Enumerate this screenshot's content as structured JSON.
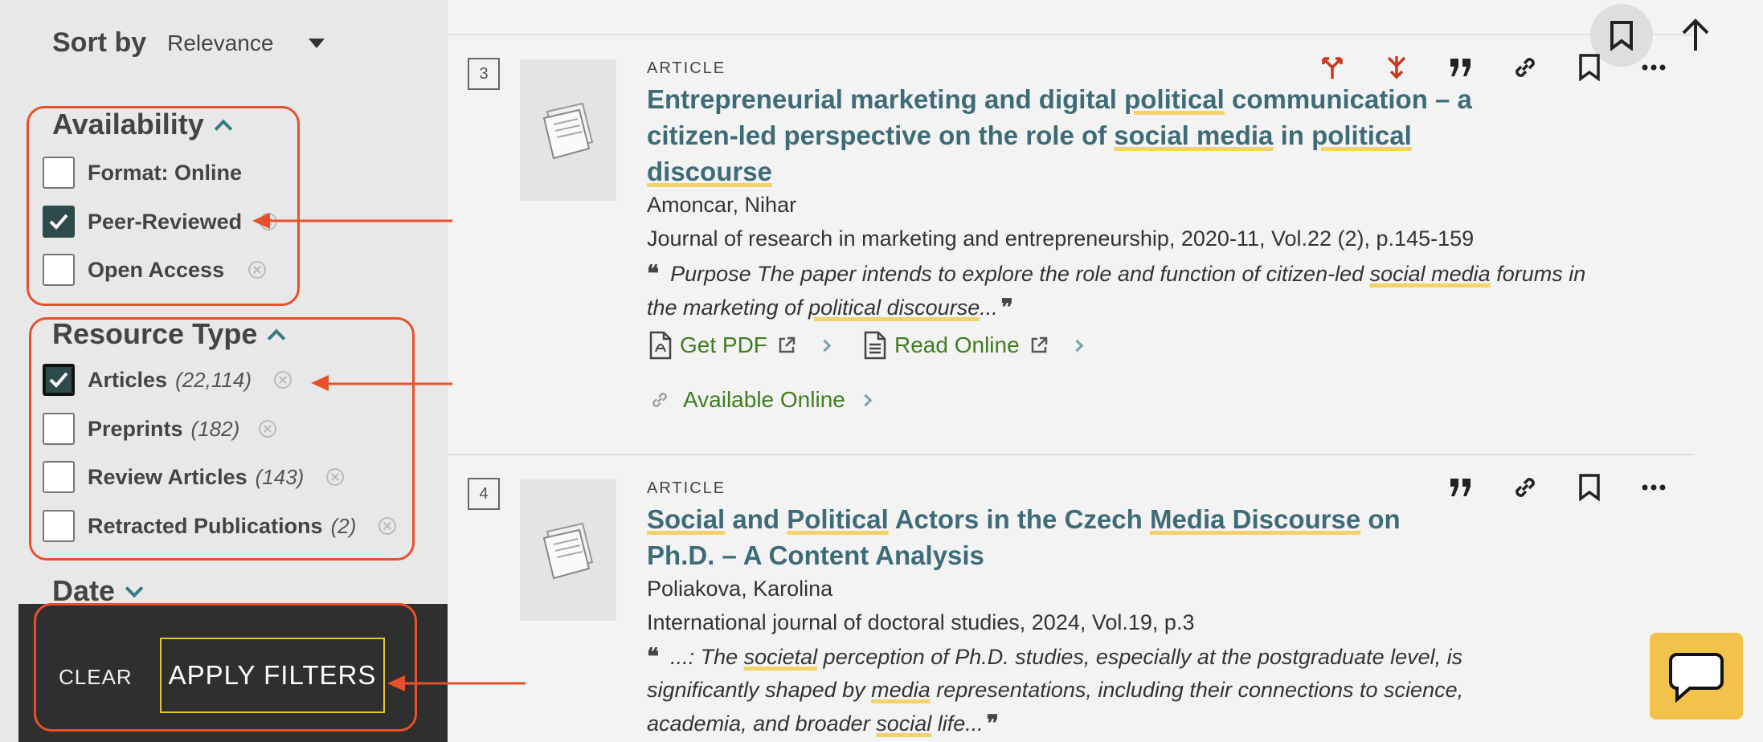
{
  "sidebar": {
    "sort_label": "Sort by",
    "sort_value": "Relevance",
    "availability": {
      "heading": "Availability",
      "options": [
        {
          "label": "Format: Online",
          "checked": false
        },
        {
          "label": "Peer-Reviewed",
          "checked": true
        },
        {
          "label": "Open Access",
          "checked": false
        }
      ]
    },
    "resource_type": {
      "heading": "Resource Type",
      "options": [
        {
          "label": "Articles",
          "count": "(22,114)",
          "checked": true
        },
        {
          "label": "Preprints",
          "count": "(182)",
          "checked": false
        },
        {
          "label": "Review Articles",
          "count": "(143)",
          "checked": false
        },
        {
          "label": "Retracted Publications",
          "count": "(2)",
          "checked": false
        }
      ]
    },
    "date_heading": "Date",
    "clear_label": "CLEAR",
    "apply_label": "APPLY FILTERS"
  },
  "results": [
    {
      "number": "3",
      "type": "ARTICLE",
      "title_parts": [
        "Entrepreneurial marketing and digital ",
        "political",
        " communication – a citizen-led perspective on the role of ",
        "social media",
        " in ",
        "political",
        " ",
        "discourse"
      ],
      "author": "Amoncar, Nihar",
      "source": "Journal of research in marketing and entrepreneurship, 2020-11, Vol.22 (2), p.145-159",
      "snippet_parts": [
        "Purpose The paper intends to explore the role and function of citizen-led ",
        "social media",
        " forums in the marketing of ",
        "political discourse",
        "..."
      ],
      "get_pdf": "Get PDF",
      "read_online": "Read Online",
      "available_online": "Available Online"
    },
    {
      "number": "4",
      "type": "ARTICLE",
      "title_parts": [
        "Social",
        " and ",
        "Political",
        " Actors in the Czech ",
        "Media Discourse",
        " on Ph.D. – A Content Analysis"
      ],
      "author": "Poliakova, Karolina",
      "source": "International journal of doctoral studies, 2024, Vol.19, p.3",
      "snippet_parts": [
        "...: The ",
        "societal",
        " perception of Ph.D. studies, especially at the postgraduate level, is significantly shaped by ",
        "media",
        " representations, including their connections to science, academia, and broader ",
        "social",
        " life..."
      ]
    }
  ],
  "colors": {
    "accent_teal": "#3e6b78",
    "link_green": "#3f7d1f",
    "annotation_red": "#e8502b",
    "highlight_yellow": "#f2d36b",
    "chat_yellow": "#f3c24a"
  },
  "icons": [
    "bookmark-icon",
    "arrow-up-icon",
    "merge-icon",
    "split-icon",
    "quote-icon",
    "link-icon",
    "more-icon",
    "pdf-icon",
    "document-icon",
    "external-link-icon",
    "chat-icon",
    "check-icon",
    "clear-icon"
  ]
}
